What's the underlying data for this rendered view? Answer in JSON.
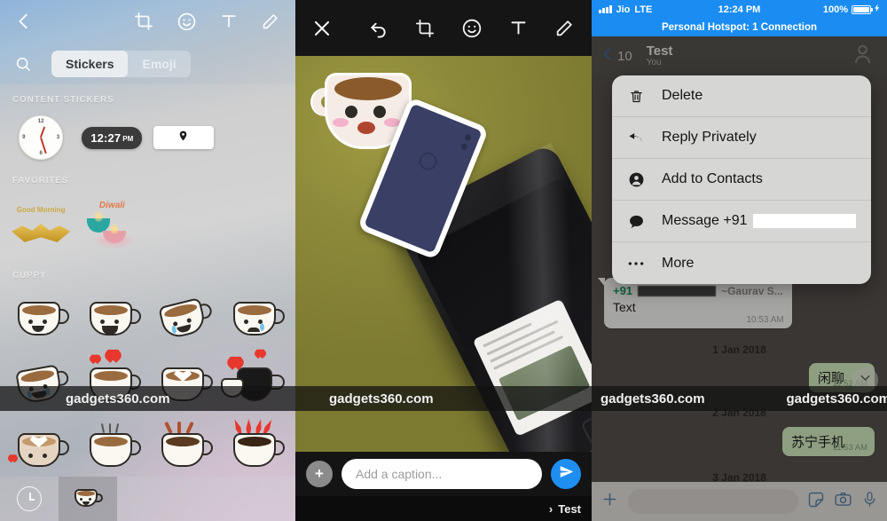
{
  "panel1": {
    "name": "sticker-picker",
    "toolbar": {
      "back_icon": "chevron-left-icon",
      "crop_icon": "crop-rotate-icon",
      "sticker_icon": "smiley-icon",
      "text_icon": "text-tool-icon",
      "draw_icon": "pencil-icon"
    },
    "search_icon": "search-icon",
    "tabs": [
      {
        "label": "Stickers",
        "active": true
      },
      {
        "label": "Emoji",
        "active": false
      }
    ],
    "sections": [
      {
        "label": "CONTENT STICKERS"
      },
      {
        "label": "FAVORITES"
      },
      {
        "label": "CUPPY"
      }
    ],
    "content_stickers": {
      "clock_label": "clock-sticker",
      "time_value": "12:27",
      "time_meridiem": "PM",
      "location_label": "location-pin-sticker"
    },
    "favorites": [
      {
        "name": "golden-wings-sticker",
        "caption": "Good Morning"
      },
      {
        "name": "diwali-diya-sticker",
        "caption": "Diwali"
      }
    ],
    "cuppy_stickers": [
      "cup-smiling",
      "cup-laughing",
      "cup-crying-happy",
      "cup-crying-sad",
      "cup-sobbing",
      "cup-hearts",
      "cup-latte-heart",
      "cup-black-love",
      "cup-latte-art-heart",
      "cup-steaming",
      "cup-splash",
      "cup-fire-hot"
    ],
    "tabbar": {
      "recents_icon": "recents-clock-icon",
      "cuppy_tab_icon": "cuppy-pack-icon"
    },
    "watermark": "gadgets360.com"
  },
  "panel2": {
    "name": "photo-editor",
    "toolbar": {
      "close_icon": "close-icon",
      "undo_icon": "undo-icon",
      "crop_icon": "crop-rotate-icon",
      "sticker_icon": "smiley-icon",
      "text_icon": "text-tool-icon",
      "draw_icon": "pencil-icon"
    },
    "applied_stickers": [
      "cuppy-face-sticker",
      "blue-phone-sticker"
    ],
    "caption_placeholder": "Add a caption...",
    "add_button_label": "+",
    "send_icon": "send-icon",
    "recipient_prefix": "›",
    "recipient": "Test",
    "watermark": "gadgets360.com"
  },
  "panel3": {
    "name": "chat-context-menu",
    "statusbar": {
      "carrier": "Jio",
      "network": "LTE",
      "time": "12:24 PM",
      "battery_percent": "100%",
      "signal_icon": "signal-bars-icon",
      "battery_icon": "battery-full-icon",
      "charging_icon": "charging-bolt-icon"
    },
    "hotspot_banner": "Personal Hotspot: 1 Connection",
    "navbar": {
      "back_icon": "chevron-left-icon",
      "unread_count": "10",
      "title": "Test",
      "subtitle": "You",
      "profile_icon": "group-avatar-icon"
    },
    "context_menu": [
      {
        "label": "Delete",
        "icon": "trash-icon"
      },
      {
        "label": "Reply Privately",
        "icon": "reply-arrow-icon"
      },
      {
        "label": "Add to Contacts",
        "icon": "contact-person-icon"
      },
      {
        "label": "Message +91",
        "icon": "chat-bubble-icon",
        "redacted": true
      },
      {
        "label": "More",
        "icon": "ellipsis-icon"
      }
    ],
    "messages": [
      {
        "type": "incoming",
        "sender_prefix": "+91",
        "sender_alias": "~Gaurav S...",
        "text": "Text",
        "time": "10:53 AM"
      },
      {
        "type": "separator",
        "label": "1 Jan 2018"
      },
      {
        "type": "outgoing",
        "text": "闲聊",
        "time": "11:52 AM"
      },
      {
        "type": "separator",
        "label": "2 Jan 2018"
      },
      {
        "type": "outgoing",
        "text": "苏宁手机",
        "time": "11:53 AM"
      },
      {
        "type": "separator",
        "label": "3 Jan 2018"
      }
    ],
    "scroll_down_icon": "chevron-down-circle-icon",
    "inputbar": {
      "plus_icon": "plus-icon",
      "field_value": "",
      "sticker_icon": "sticker-icon",
      "camera_icon": "camera-icon",
      "mic_icon": "microphone-icon"
    },
    "watermark": "gadgets360.com"
  },
  "colors": {
    "accent_blue": "#1b8cf2",
    "send_blue": "#1f8ef1",
    "outgoing_bubble": "#d8f1c4",
    "sender_green": "#1d9b63",
    "menu_bg": "#d6d6d4",
    "navbar": "#595550"
  }
}
